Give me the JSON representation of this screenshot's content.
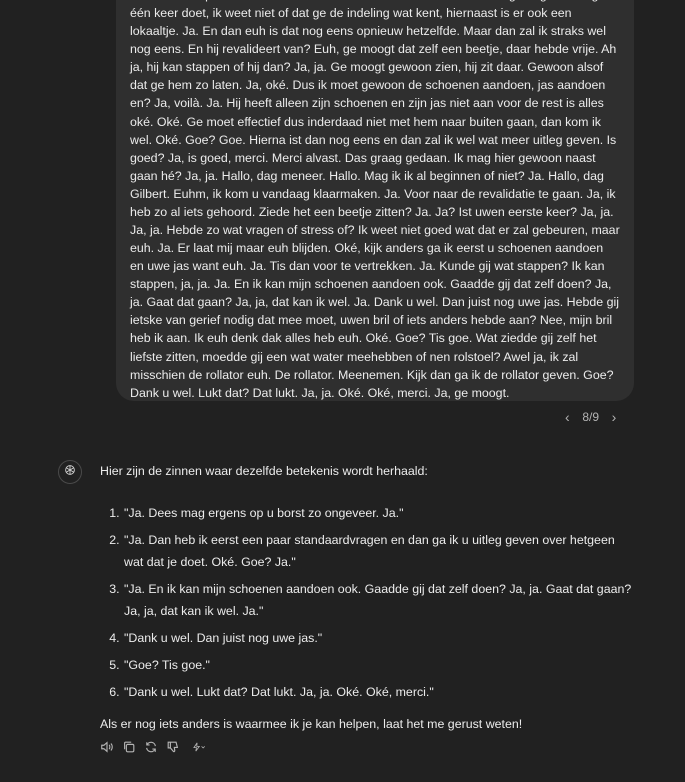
{
  "user_message": {
    "text": "naar buiten lopen. Oké. Dan kom ik hier wel en hierna ist de bedoeling dat ge dat nog één keer doet, ik weet niet of dat ge de indeling wat kent, hiernaast is er ook een lokaaltje. Ja. En dan euh is dat nog eens opnieuw hetzelfde. Maar dan zal ik straks wel nog eens. En hij revalideert van? Euh, ge moogt dat zelf een beetje, daar hebde vrije. Ah ja, hij kan stappen of hij dan? Ja, ja. Ge moogt gewoon zien, hij zit daar. Gewoon alsof dat ge hem zo laten. Ja, oké. Dus ik moet gewoon de schoenen aandoen, jas aandoen en? Ja, voilà. Ja. Hij heeft alleen zijn schoenen en zijn jas niet aan voor de rest is alles oké. Oké. Ge moet effectief dus inderdaad niet met hem naar buiten gaan, dan kom ik wel.  Oké. Goe? Goe. Hierna ist dan nog eens en dan zal ik wel wat meer uitleg geven. Is goed? Ja, is goed, merci. Merci alvast. Das graag gedaan. Ik mag hier gewoon naast gaan hé? Ja, ja. Hallo, dag meneer. Hallo. Mag ik ik al beginnen of niet? Ja. Hallo, dag Gilbert. Euhm, ik kom u vandaag klaarmaken. Ja. Voor naar de revalidatie te gaan. Ja, ik heb zo al iets gehoord. Ziede het een beetje zitten? Ja. Ja? Ist uwen eerste keer? Ja, ja. Ja, ja. Hebde zo wat vragen of stress of? Ik weet niet goed wat dat er zal gebeuren, maar euh. Ja. Er laat mij maar euh blijden. Oké, kijk anders ga ik eerst u schoenen aandoen en uwe jas want euh. Ja. Tis dan voor te vertrekken. Ja. Kunde gij wat stappen? Ik kan stappen, ja, ja. Ja. En ik kan mijn schoenen aandoen ook. Gaadde gij dat zelf doen? Ja, ja. Gaat dat gaan? Ja, ja, dat kan ik wel. Ja. Dank u wel. Dan juist nog uwe jas. Hebde gij ietske van gerief nodig dat mee moet, uwen bril of iets anders hebde aan? Nee, mijn bril heb ik aan. Ik euh denk dak alles heb euh. Oké. Goe? Tis goe. Wat ziedde gij zelf het liefste zitten, moedde gij een wat water meehebben of nen rolstoel? Awel ja, ik zal misschien de rollator euh. De rollator. Meenemen. Kijk dan ga ik de rollator geven. Goe? Dank u wel. Lukt dat? Dat lukt. Ja, ja. Oké. Oké, merci. Ja, ge moogt."
  },
  "pager": {
    "label": "8/9"
  },
  "assistant": {
    "intro": "Hier zijn de zinnen waar dezelfde betekenis wordt herhaald:",
    "items": [
      "\"Ja. Dees mag ergens op u borst zo ongeveer. Ja.\"",
      "\"Ja. Dan heb ik eerst een paar standaardvragen en dan ga ik u uitleg geven over hetgeen wat dat je doet. Oké. Goe? Ja.\"",
      "\"Ja. En ik kan mijn schoenen aandoen ook. Gaadde gij dat zelf doen? Ja, ja. Gaat dat gaan? Ja, ja, dat kan ik wel. Ja.\"",
      "\"Dank u wel. Dan juist nog uwe jas.\"",
      "\"Goe? Tis goe.\"",
      "\"Dank u wel. Lukt dat? Dat lukt. Ja, ja. Oké. Oké, merci.\""
    ],
    "outro": "Als er nog iets anders is waarmee ik je kan helpen, laat het me gerust weten!"
  },
  "actions": [
    "read-aloud-icon",
    "copy-icon",
    "regenerate-icon",
    "thumbs-down-icon",
    "model-switch-icon"
  ]
}
